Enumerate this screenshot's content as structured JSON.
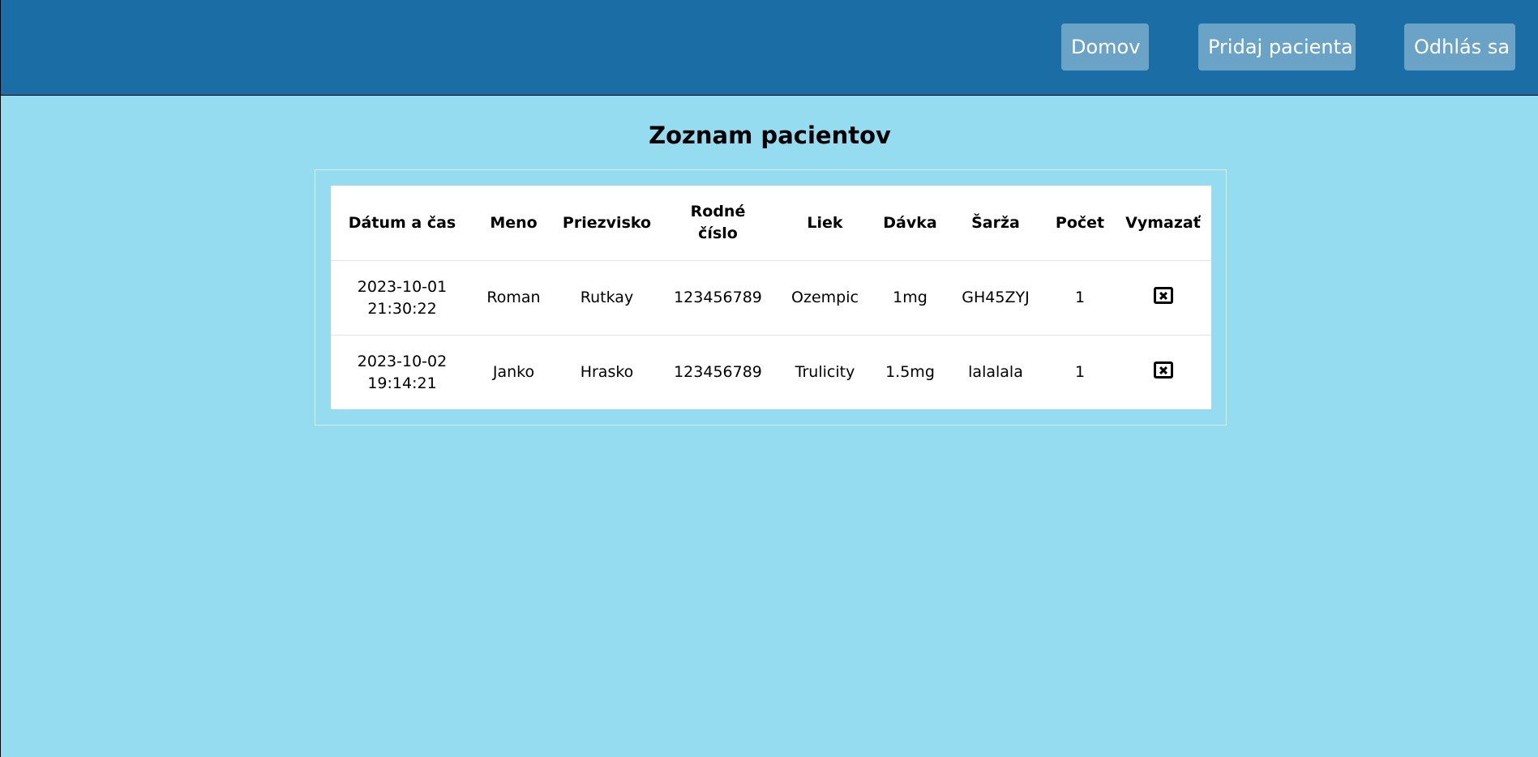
{
  "nav": {
    "home_label": "Domov",
    "add_patient_label": "Pridaj pacienta",
    "logout_label": "Odhlás sa"
  },
  "page_title": "Zoznam pacientov",
  "table": {
    "headers": {
      "datetime": "Dátum a čas",
      "first_name": "Meno",
      "last_name": "Priezvisko",
      "birth_number_line1": "Rodné",
      "birth_number_line2": "číslo",
      "drug": "Liek",
      "dose": "Dávka",
      "batch": "Šarža",
      "count": "Počet",
      "delete": "Vymazať"
    },
    "rows": [
      {
        "date": "2023-10-01",
        "time": "21:30:22",
        "first_name": "Roman",
        "last_name": "Rutkay",
        "birth_number": "123456789",
        "drug": "Ozempic",
        "dose": "1mg",
        "batch": "GH45ZYJ",
        "count": "1",
        "delete_icon": "close-box-icon"
      },
      {
        "date": "2023-10-02",
        "time": "19:14:21",
        "first_name": "Janko",
        "last_name": "Hrasko",
        "birth_number": "123456789",
        "drug": "Trulicity",
        "dose": "1.5mg",
        "batch": "lalalala",
        "count": "1",
        "delete_icon": "close-box-icon"
      }
    ]
  },
  "colors": {
    "header_bar": "#1a6ea5",
    "nav_button": "#6aa3c6",
    "page_background": "#96dcf1",
    "table_background": "#ffffff"
  }
}
